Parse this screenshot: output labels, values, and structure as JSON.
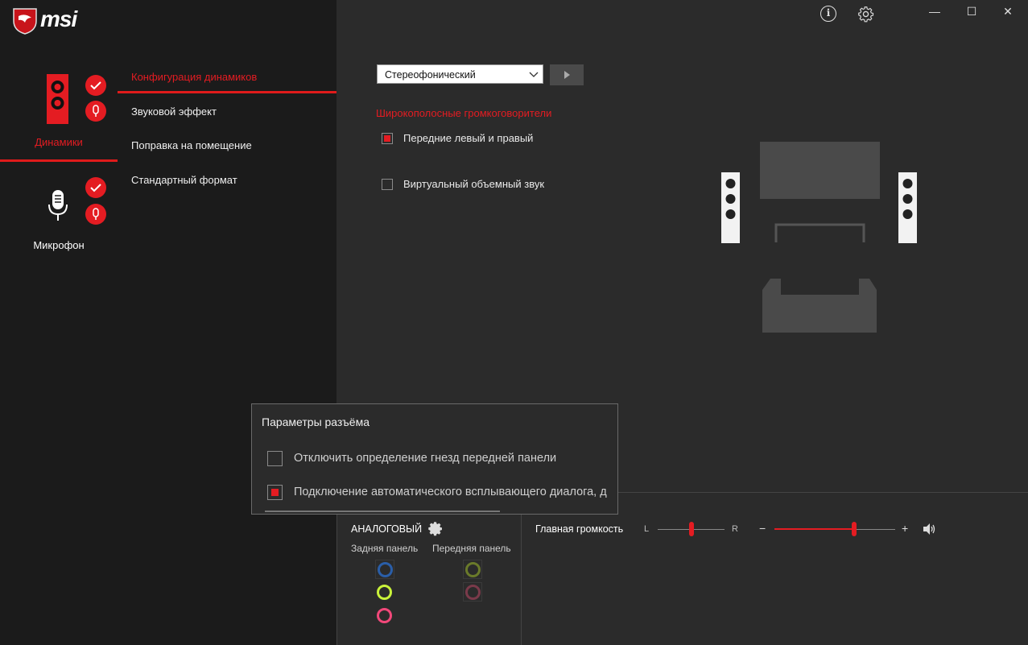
{
  "app": {
    "brand": "msi"
  },
  "window": {
    "info_label": "i",
    "minimize": "—",
    "maximize": "☐",
    "close": "✕"
  },
  "devices": [
    {
      "label": "Динамики",
      "active": true
    },
    {
      "label": "Микрофон",
      "active": false
    }
  ],
  "submenu": {
    "items": [
      "Конфигурация динамиков",
      "Звуковой эффект",
      "Поправка на помещение",
      "Стандартный формат"
    ],
    "active_index": 0
  },
  "config": {
    "dropdown_value": "Стереофонический",
    "section_title": "Широкополосные громкоговорители",
    "options": [
      {
        "label": "Передние левый и правый",
        "checked": true
      },
      {
        "label": "Виртуальный объемный звук",
        "checked": false
      }
    ]
  },
  "popup": {
    "title": "Параметры разъёма",
    "options": [
      {
        "label": "Отключить определение гнезд передней панели",
        "checked": false
      },
      {
        "label": "Подключение автоматического всплывающего диалога, д",
        "checked": true
      }
    ]
  },
  "analog": {
    "title": "АНАЛОГОВЫЙ",
    "rear_label": "Задняя панель",
    "front_label": "Передняя панель",
    "rear_jacks": [
      {
        "color": "#2a5ea8",
        "active": false
      },
      {
        "color": "#c9f23a",
        "active": true
      },
      {
        "color": "#f2487a",
        "active": true
      }
    ],
    "front_jacks": [
      {
        "color": "#6a7a2a",
        "active": false
      },
      {
        "color": "#7a3a4a",
        "active": false
      }
    ]
  },
  "volume": {
    "label": "Главная громкость",
    "balance_left": "L",
    "balance_right": "R",
    "balance": 0.5,
    "minus": "−",
    "plus": "+",
    "level": 0.66
  },
  "colors": {
    "accent": "#e41c22",
    "background": "#2b2b2b",
    "sidebar": "#1b1b1b"
  }
}
